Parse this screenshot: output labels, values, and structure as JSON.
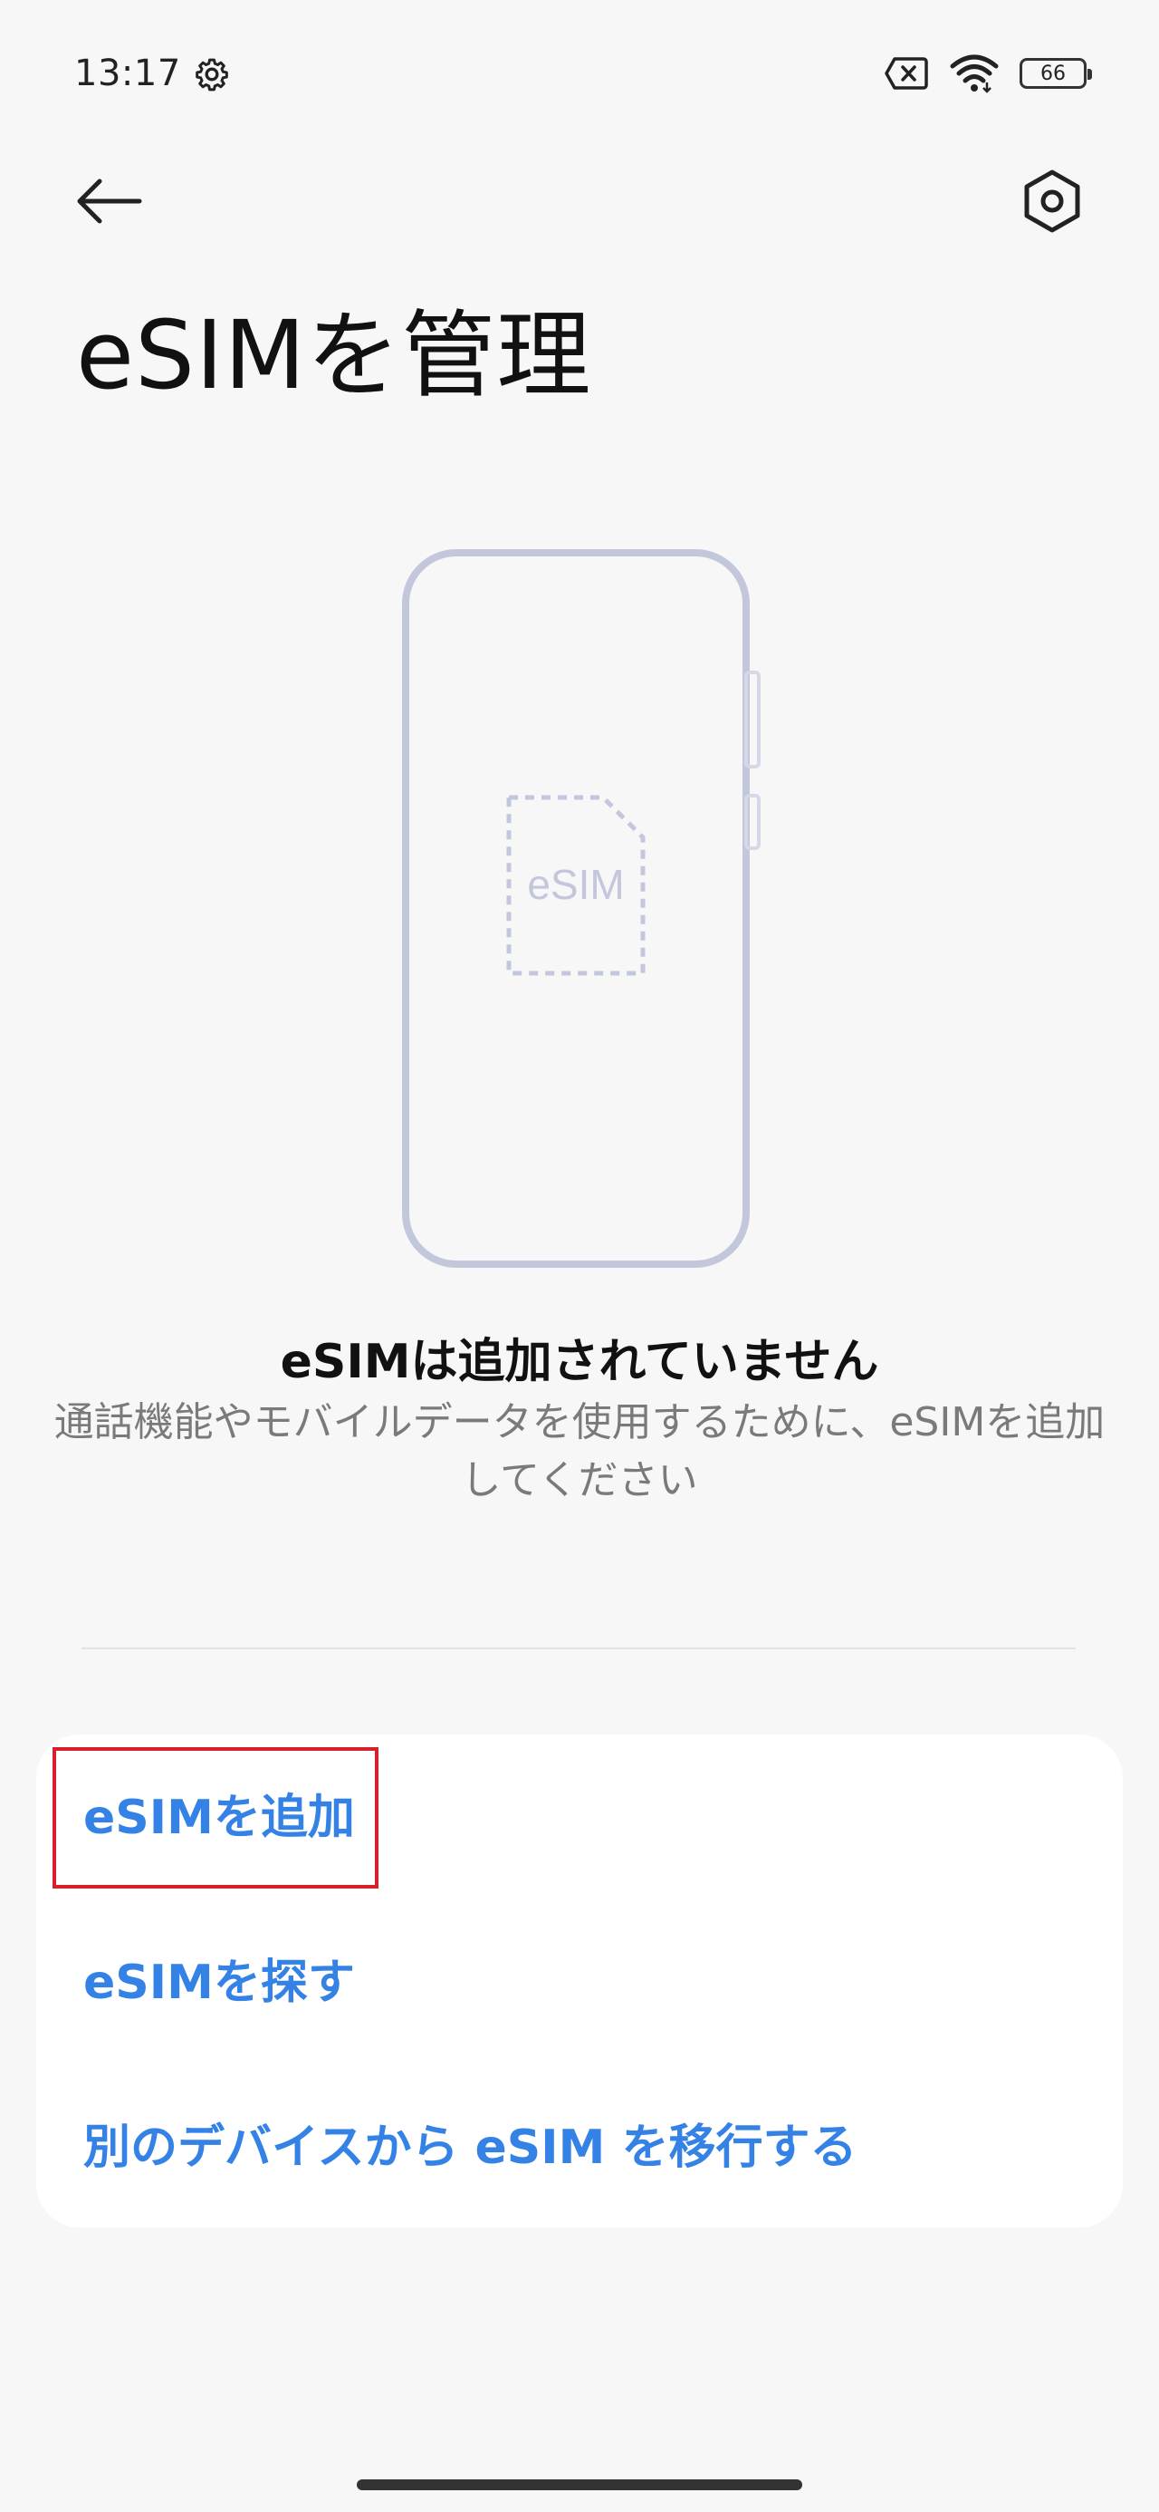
{
  "status_bar": {
    "time": "13:17",
    "battery_level": "66",
    "icons": [
      "settings-gear-icon",
      "no-sim-icon",
      "wifi-icon",
      "battery-icon"
    ]
  },
  "header": {
    "back_icon": "arrow-left-icon",
    "settings_icon": "settings-hexagon-icon",
    "title": "eSIMを管理"
  },
  "illustration": {
    "sim_label": "eSIM"
  },
  "empty_state": {
    "title": "eSIMは追加されていません",
    "description": "通話機能やモバイルデータを使用するために、eSIMを追加してください"
  },
  "actions": {
    "add_esim": "eSIMを追加",
    "find_esim": "eSIMを探す",
    "transfer_esim": "別のデバイスから eSIM を移行する"
  },
  "colors": {
    "accent": "#3482e6",
    "highlight": "#d8202a",
    "illustration_stroke": "#c3c7dc",
    "background": "#f7f7f7"
  }
}
